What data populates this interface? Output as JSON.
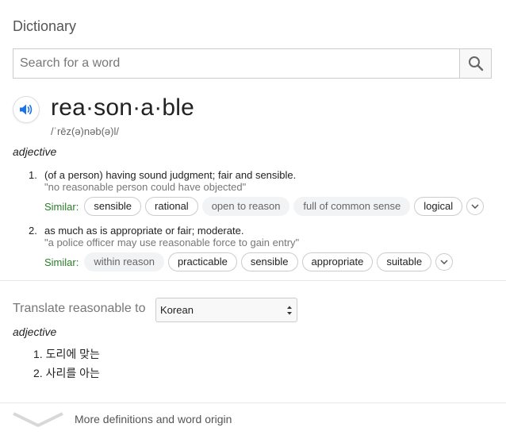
{
  "header": {
    "title": "Dictionary"
  },
  "search": {
    "placeholder": "Search for a word",
    "value": ""
  },
  "entry": {
    "word": "rea·son·a·ble",
    "phonetic": "/ˈrēz(ə)nəb(ə)l/",
    "part_of_speech": "adjective",
    "definitions": [
      {
        "number": "1.",
        "text": "(of a person) having sound judgment; fair and sensible.",
        "example": "\"no reasonable person could have objected\"",
        "similar_label": "Similar:",
        "similar": [
          {
            "word": "sensible",
            "style": "outlined"
          },
          {
            "word": "rational",
            "style": "outlined"
          },
          {
            "word": "open to reason",
            "style": "plain"
          },
          {
            "word": "full of common sense",
            "style": "plain"
          },
          {
            "word": "logical",
            "style": "outlined"
          }
        ]
      },
      {
        "number": "2.",
        "text": "as much as is appropriate or fair; moderate.",
        "example": "\"a police officer may use reasonable force to gain entry\"",
        "similar_label": "Similar:",
        "similar": [
          {
            "word": "within reason",
            "style": "plain"
          },
          {
            "word": "practicable",
            "style": "outlined"
          },
          {
            "word": "sensible",
            "style": "outlined"
          },
          {
            "word": "appropriate",
            "style": "outlined"
          },
          {
            "word": "suitable",
            "style": "outlined"
          }
        ]
      }
    ]
  },
  "translate": {
    "label": "Translate reasonable to",
    "language": "Korean",
    "part_of_speech": "adjective",
    "items": [
      {
        "number": "1.",
        "text": "도리에 맞는"
      },
      {
        "number": "2.",
        "text": "사리를 아는"
      }
    ]
  },
  "footer": {
    "label": "More definitions and word origin"
  },
  "colors": {
    "similar_label": "#2a7d2a",
    "speaker_icon": "#1a73e8"
  }
}
